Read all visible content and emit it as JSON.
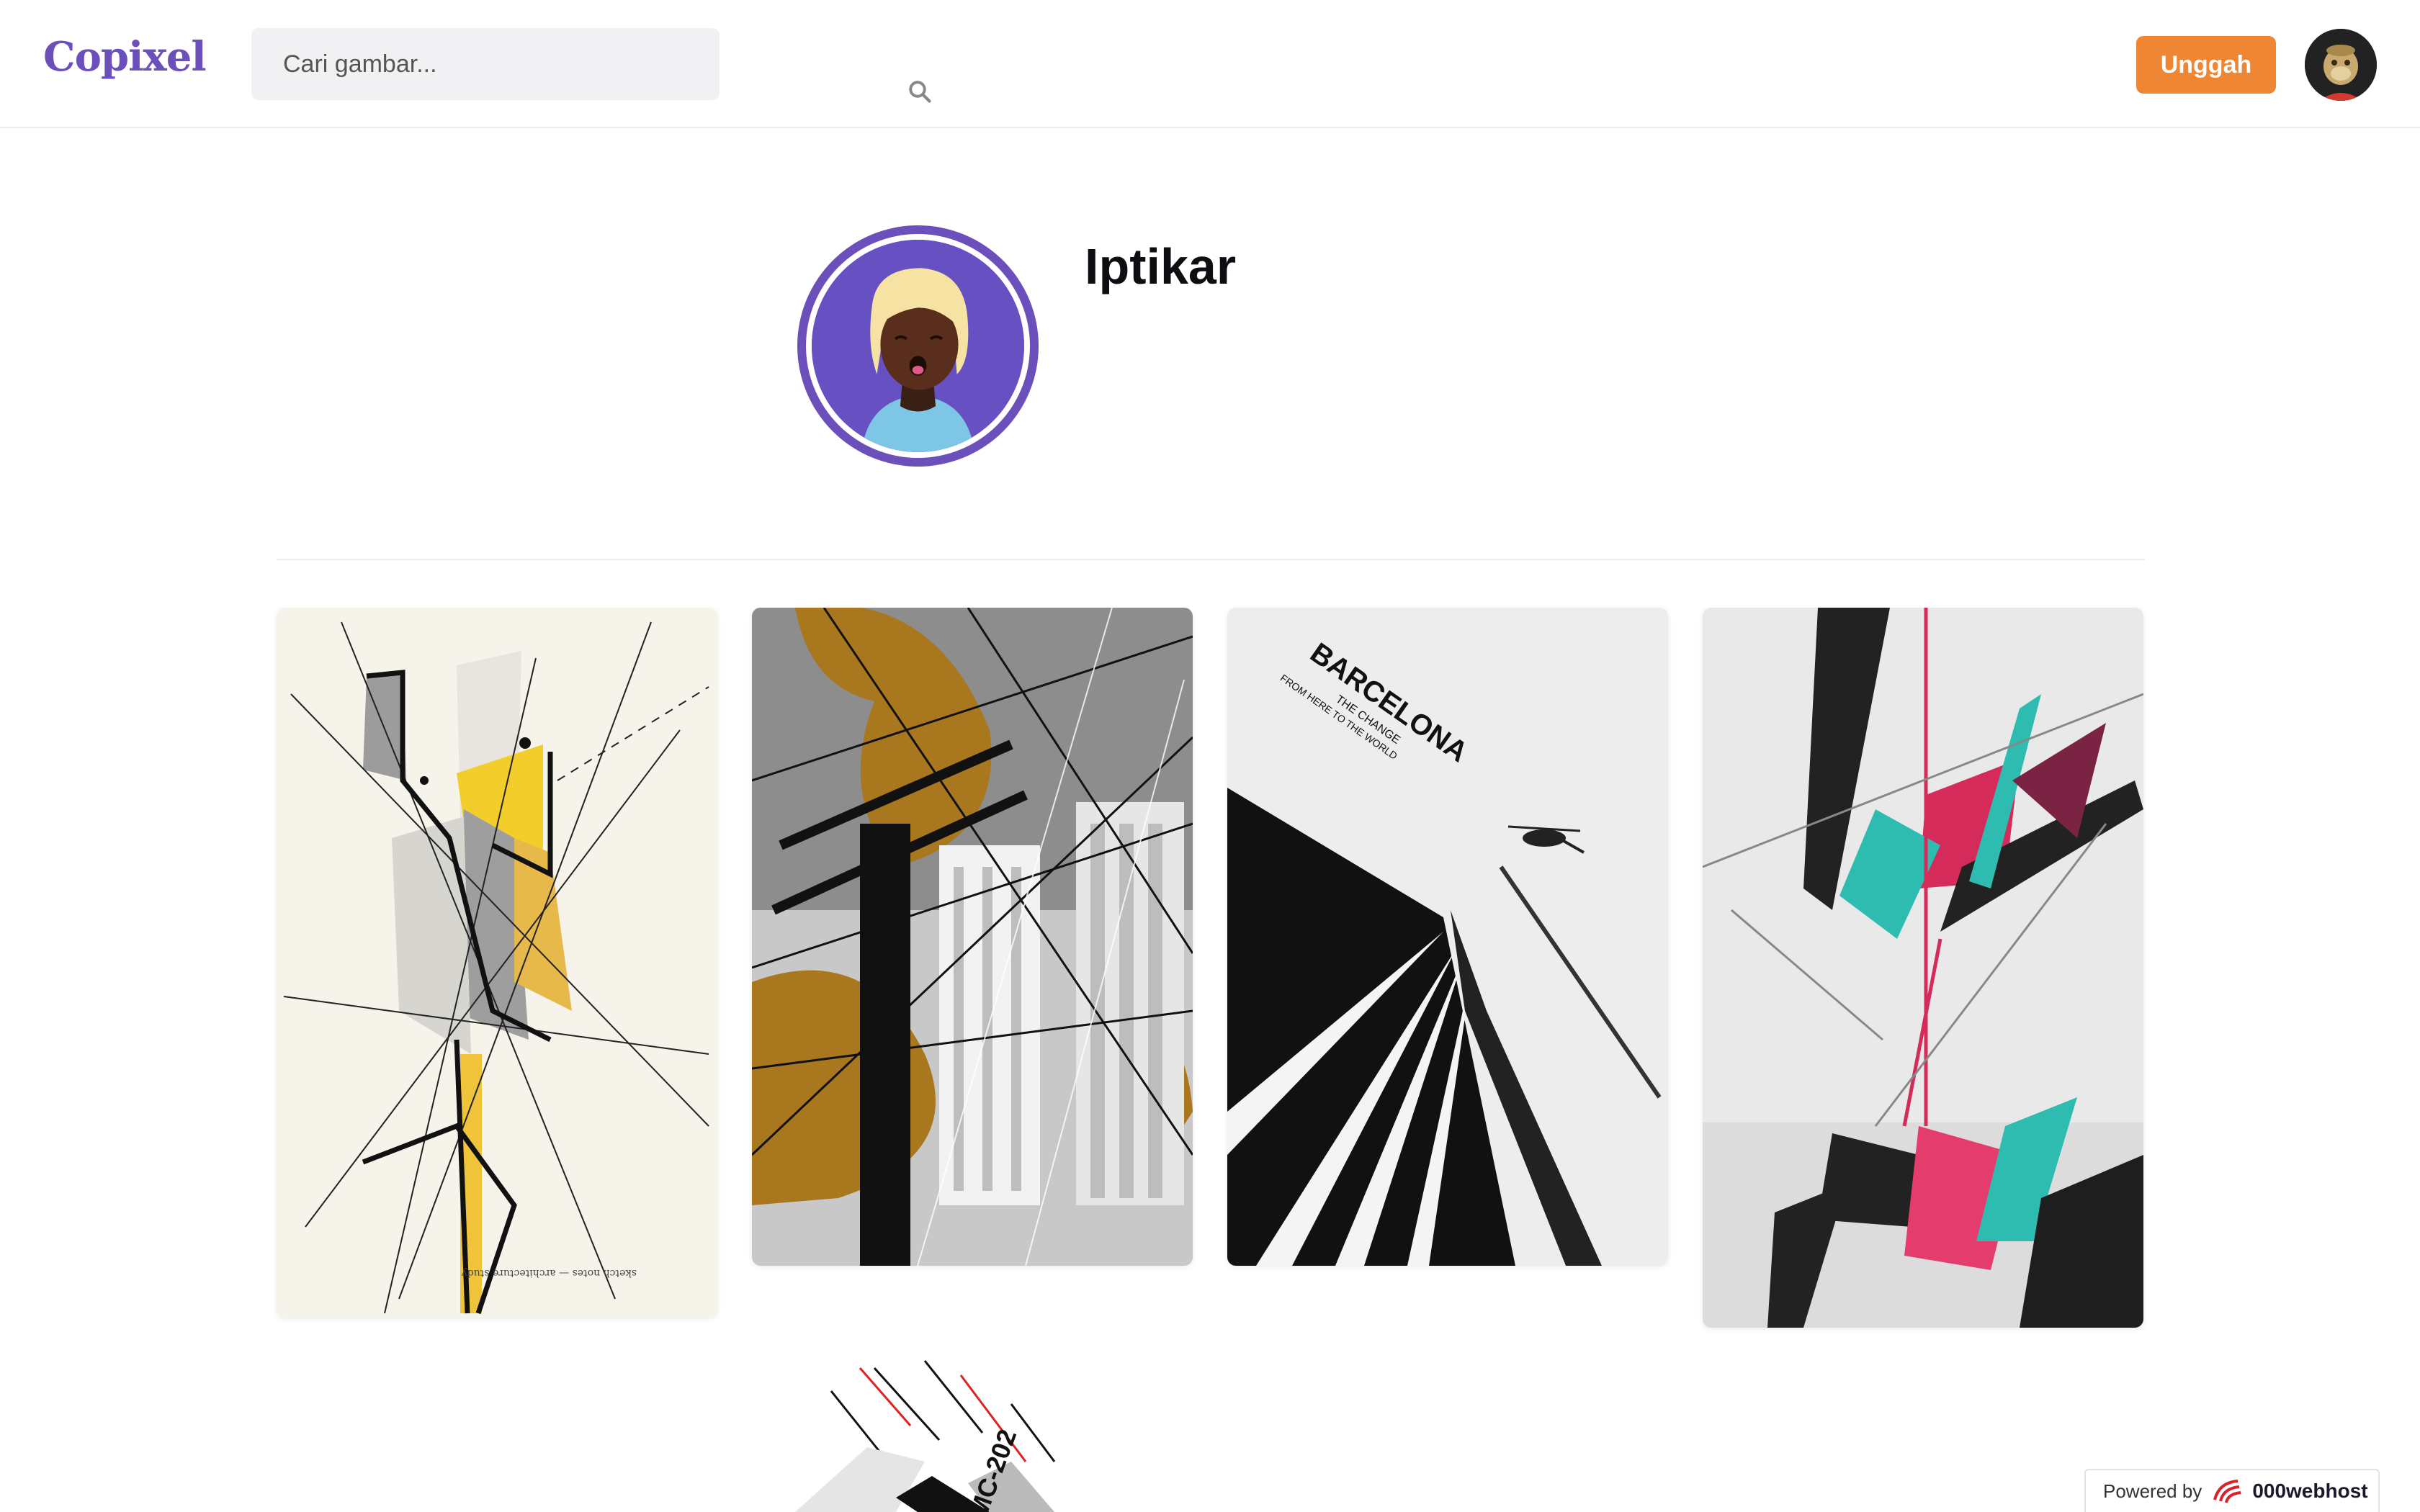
{
  "header": {
    "logo": "Copixel",
    "search_placeholder": "Cari gambar...",
    "upload_label": "Unggah"
  },
  "profile": {
    "name": "Iptikar"
  },
  "gallery": {
    "items": [
      {
        "subject": "abstract architectural line sketch with yellow shapes"
      },
      {
        "subject": "power lines over city with ochre shapes"
      },
      {
        "subject": "Barcelona poster with helicopter",
        "poster_title": "BARCELONA",
        "poster_lines": [
          "THE CHANGE",
          "FROM HERE TO THE WORLD"
        ]
      },
      {
        "subject": "abstract red and teal geometric art"
      },
      {
        "subject": "abstract poster with MC-202 text",
        "poster_text": "MC-202"
      }
    ]
  },
  "footer": {
    "powered_by": "Powered by",
    "host": "000webhost"
  },
  "colors": {
    "brand": "#6b4fbb",
    "accent": "#ee8634"
  }
}
